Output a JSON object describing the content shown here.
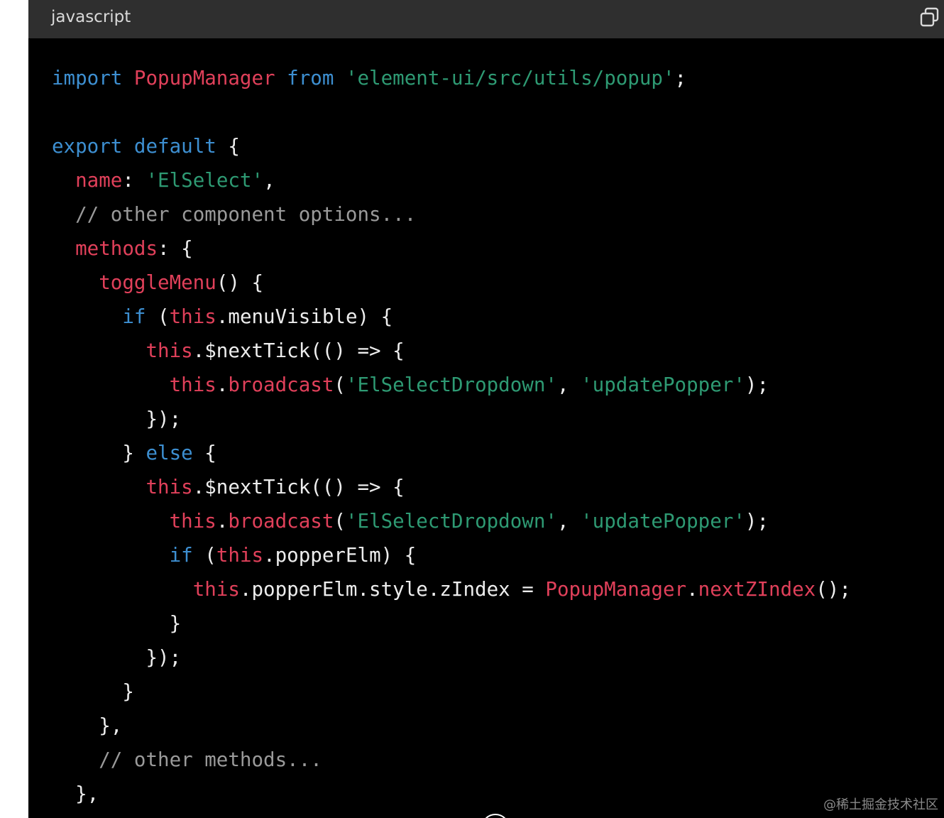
{
  "header": {
    "language": "javascript",
    "copy_icon": "copy-icon"
  },
  "code_lines": [
    [
      [
        "kw",
        "import"
      ],
      [
        "pn",
        " "
      ],
      [
        "id",
        "PopupManager"
      ],
      [
        "pn",
        " "
      ],
      [
        "kw",
        "from"
      ],
      [
        "pn",
        " "
      ],
      [
        "str",
        "'element-ui/src/utils/popup'"
      ],
      [
        "pn",
        ";"
      ]
    ],
    [],
    [
      [
        "kw",
        "export"
      ],
      [
        "pn",
        " "
      ],
      [
        "kw",
        "default"
      ],
      [
        "pn",
        " {"
      ]
    ],
    [
      [
        "pn",
        "  "
      ],
      [
        "id",
        "name"
      ],
      [
        "pn",
        ": "
      ],
      [
        "str",
        "'ElSelect'"
      ],
      [
        "pn",
        ","
      ]
    ],
    [
      [
        "pn",
        "  "
      ],
      [
        "cm",
        "// other component options..."
      ]
    ],
    [
      [
        "pn",
        "  "
      ],
      [
        "id",
        "methods"
      ],
      [
        "pn",
        ": {"
      ]
    ],
    [
      [
        "pn",
        "    "
      ],
      [
        "id",
        "toggleMenu"
      ],
      [
        "pn",
        "() {"
      ]
    ],
    [
      [
        "pn",
        "      "
      ],
      [
        "kw",
        "if"
      ],
      [
        "pn",
        " ("
      ],
      [
        "id",
        "this"
      ],
      [
        "pn",
        ".menuVisible) {"
      ]
    ],
    [
      [
        "pn",
        "        "
      ],
      [
        "id",
        "this"
      ],
      [
        "pn",
        ".$nextTick(() => {"
      ]
    ],
    [
      [
        "pn",
        "          "
      ],
      [
        "id",
        "this"
      ],
      [
        "pn",
        "."
      ],
      [
        "id",
        "broadcast"
      ],
      [
        "pn",
        "("
      ],
      [
        "str",
        "'ElSelectDropdown'"
      ],
      [
        "pn",
        ", "
      ],
      [
        "str",
        "'updatePopper'"
      ],
      [
        "pn",
        ");"
      ]
    ],
    [
      [
        "pn",
        "        });"
      ]
    ],
    [
      [
        "pn",
        "      } "
      ],
      [
        "kw",
        "else"
      ],
      [
        "pn",
        " {"
      ]
    ],
    [
      [
        "pn",
        "        "
      ],
      [
        "id",
        "this"
      ],
      [
        "pn",
        ".$nextTick(() => {"
      ]
    ],
    [
      [
        "pn",
        "          "
      ],
      [
        "id",
        "this"
      ],
      [
        "pn",
        "."
      ],
      [
        "id",
        "broadcast"
      ],
      [
        "pn",
        "("
      ],
      [
        "str",
        "'ElSelectDropdown'"
      ],
      [
        "pn",
        ", "
      ],
      [
        "str",
        "'updatePopper'"
      ],
      [
        "pn",
        ");"
      ]
    ],
    [
      [
        "pn",
        "          "
      ],
      [
        "kw",
        "if"
      ],
      [
        "pn",
        " ("
      ],
      [
        "id",
        "this"
      ],
      [
        "pn",
        ".popperElm) {"
      ]
    ],
    [
      [
        "pn",
        "            "
      ],
      [
        "id",
        "this"
      ],
      [
        "pn",
        ".popperElm.style.zIndex = "
      ],
      [
        "id",
        "PopupManager"
      ],
      [
        "pn",
        "."
      ],
      [
        "id",
        "nextZIndex"
      ],
      [
        "pn",
        "();"
      ]
    ],
    [
      [
        "pn",
        "          }"
      ]
    ],
    [
      [
        "pn",
        "        });"
      ]
    ],
    [
      [
        "pn",
        "      }"
      ]
    ],
    [
      [
        "pn",
        "    },"
      ]
    ],
    [
      [
        "pn",
        "    "
      ],
      [
        "cm",
        "// other methods..."
      ]
    ],
    [
      [
        "pn",
        "  },"
      ]
    ]
  ],
  "watermark": "@稀土掘金技术社区"
}
